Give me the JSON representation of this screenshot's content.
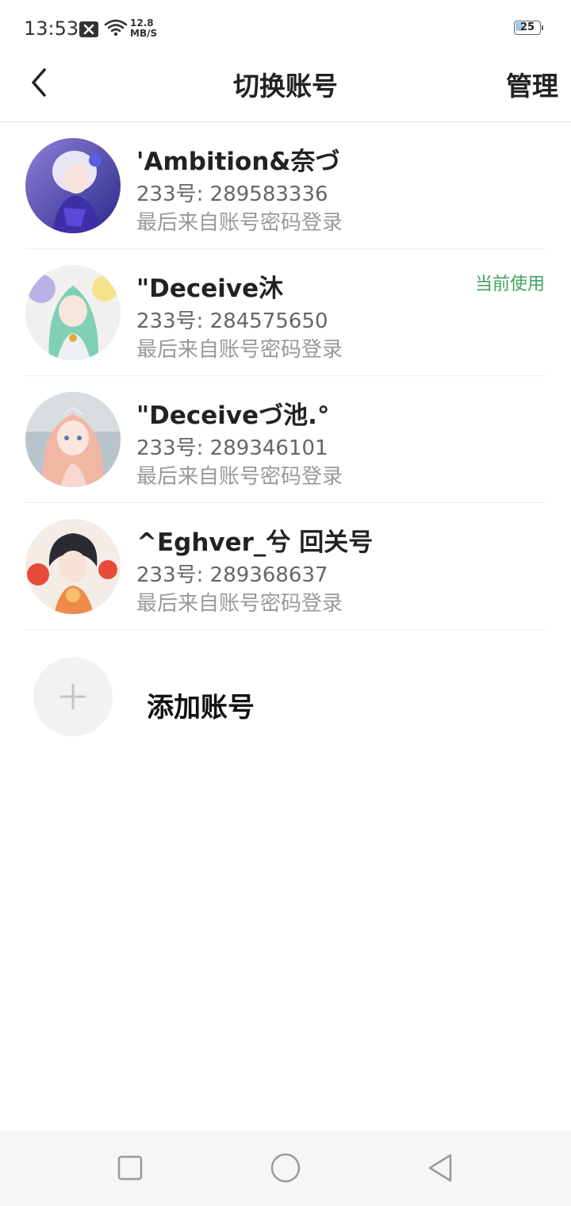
{
  "status_bar": {
    "time": "13:53",
    "net_speed_value": "12.8",
    "net_speed_unit": "MB/S",
    "battery_level": "25",
    "icons": [
      "notification-x-icon",
      "wifi-icon",
      "battery-icon"
    ]
  },
  "header": {
    "title": "切换账号",
    "manage_label": "管理",
    "back_icon": "back-arrow-icon"
  },
  "accounts": [
    {
      "name": "'Ambition&奈づ",
      "id_text": "233号: 289583336",
      "login_text": "最后来自账号密码登录",
      "current": ""
    },
    {
      "name": "\"Deceive沐",
      "id_text": "233号: 284575650",
      "login_text": "最后来自账号密码登录",
      "current": "当前使用"
    },
    {
      "name": "\"Deceiveづ池.°",
      "id_text": "233号: 289346101",
      "login_text": "最后来自账号密码登录",
      "current": ""
    },
    {
      "name": "^Eghver_兮  回关号",
      "id_text": "233号: 289368637",
      "login_text": "最后来自账号密码登录",
      "current": ""
    }
  ],
  "add_account": {
    "label": "添加账号",
    "icon": "plus-icon"
  },
  "nav_bar": {
    "icons": [
      "recent-apps-icon",
      "home-icon",
      "back-triangle-icon"
    ]
  },
  "colors": {
    "current_badge": "#3fa35f",
    "text_primary": "#222222",
    "text_secondary": "#666666",
    "text_tertiary": "#999999"
  }
}
